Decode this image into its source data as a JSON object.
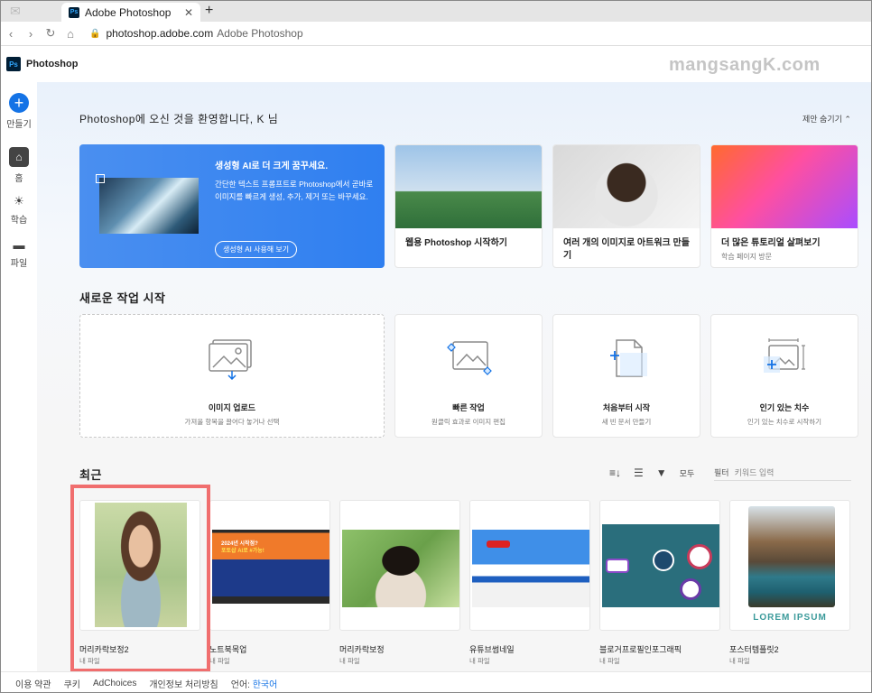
{
  "browser": {
    "tab_title": "Adobe Photoshop",
    "tab_icon_text": "Ps",
    "url": "photoshop.adobe.com",
    "url_title": "Adobe Photoshop"
  },
  "app": {
    "logo_text": "Ps",
    "name": "Photoshop",
    "watermark": "mangsangK.com"
  },
  "rail": {
    "create_label": "만들기",
    "home_label": "홈",
    "learn_label": "학습",
    "files_label": "파일"
  },
  "welcome": {
    "greeting": "Photoshop에 오신 것을 환영합니다, K 님",
    "hide_tips": "제안 숨기기"
  },
  "hero": {
    "title": "생성형 AI로 더 크게 꿈꾸세요.",
    "description": "간단한 텍스트 프롬프트로 Photoshop에서 곧바로 이미지를 빠르게 생성, 추가, 제거 또는 바꾸세요.",
    "button": "생성형 AI 사용해 보기"
  },
  "feature_cards": [
    {
      "title": "웹용 Photoshop 시작하기",
      "sub": ""
    },
    {
      "title": "여러 개의 이미지로 아트워크 만들기",
      "sub": ""
    },
    {
      "title": "더 많은 튜토리얼 살펴보기",
      "sub": "학습 페이지 방문"
    }
  ],
  "start_section": {
    "title": "새로운 작업 시작",
    "cards": [
      {
        "title": "이미지 업로드",
        "sub": "가져올 항목을 끌어다 놓거나 선택"
      },
      {
        "title": "빠른 작업",
        "sub": "원클릭 효과로 이미지 편집"
      },
      {
        "title": "처음부터 시작",
        "sub": "새 빈 문서 만들기"
      },
      {
        "title": "인기 있는 치수",
        "sub": "인기 있는 치수로 시작하기"
      }
    ]
  },
  "recent": {
    "title": "최근",
    "filter_all": "모두",
    "filter_label": "필터",
    "filter_placeholder": "키워드 입력",
    "items": [
      {
        "name": "머리카락보정2",
        "location": "내 파일"
      },
      {
        "name": "노트북목업",
        "location": "내 파일"
      },
      {
        "name": "머리카락보정",
        "location": "내 파일"
      },
      {
        "name": "유튜브썸네일",
        "location": "내 파일"
      },
      {
        "name": "블로거프로필인포그래픽",
        "location": "내 파일"
      },
      {
        "name": "포스터템플릿2",
        "location": "내 파일"
      }
    ],
    "poster_text": "LOREM IPSUM",
    "laptop_text_1": "2024년 시작점?",
    "laptop_text_2": "포토샵 AI로 #가능!"
  },
  "footer": {
    "terms": "이용 약관",
    "cookies": "쿠키",
    "adchoices": "AdChoices",
    "privacy": "개인정보 처리방침",
    "language_label": "언어:",
    "language_value": "한국어"
  },
  "colors": {
    "accent": "#1473e6",
    "hero_blue": "#2f7ff0",
    "highlight": "#f06e6e"
  }
}
